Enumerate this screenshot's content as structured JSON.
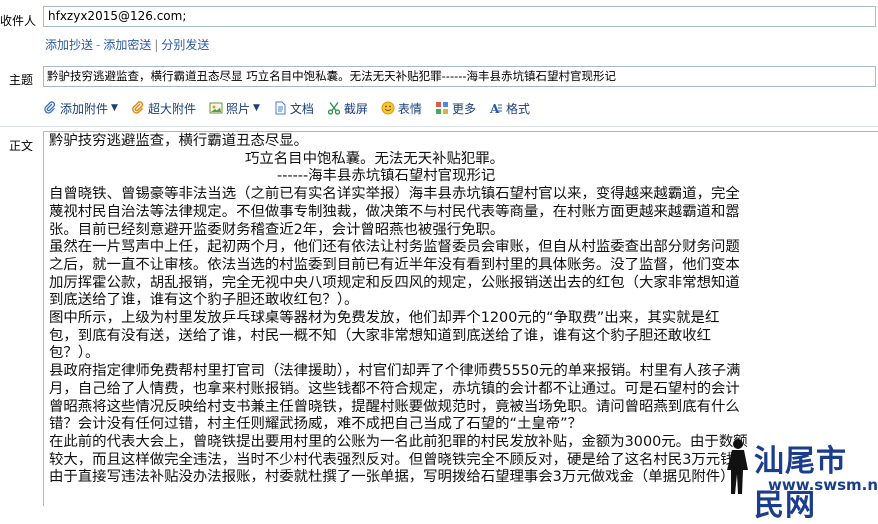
{
  "fields": {
    "to_label": "收件人",
    "to_value": "hfxzyx2015@126.com;",
    "add_cc": "添加抄送",
    "add_bcc": "添加密送",
    "separate_send": "分别发送",
    "subject_label": "主题",
    "subject_value": "黔驴技穷逃避监查，横行霸道丑态尽显   巧立名目中饱私囊。无法无天补贴犯罪------海丰县赤坑镇石望村官现形记",
    "body_label": "正文"
  },
  "toolbar": {
    "attach": "添加附件",
    "big_attach": "超大附件",
    "photo": "照片",
    "doc": "文档",
    "screenshot": "截屏",
    "emoji": "表情",
    "more": "更多",
    "format": "格式"
  },
  "body": {
    "title1": "黔驴技穷逃避监查，横行霸道丑态尽显。",
    "title2": "巧立名目中饱私囊。无法无天补贴犯罪。",
    "title3": "------海丰县赤坑镇石望村官现形记",
    "lines": [
      "自曾晓铁、曾锡豪等非法当选（之前已有实名详实举报）海丰县赤坑镇石望村官以来，变得越来越霸道，完全",
      "蔑视村民自治法等法律规定。不但做事专制独裁，做决策不与村民代表等商量，在村账方面更越来越霸道和嚣",
      "张。目前已经刻意避开监委财务稽查近2年，会计曾昭燕也被强行免职。",
      "虽然在一片骂声中上任，起初两个月，他们还有依法让村务监督委员会审账，但自从村监委查出部分财务问题",
      "之后，就一直不让审核。依法当选的村监委到目前已有近半年没有看到村里的具体账务。没了监督，他们变本",
      "加厉挥霍公款，胡乱报销，完全无视中央八项规定和反四风的规定，公账报销送出去的红包（大家非常想知道",
      "到底送给了谁，谁有这个豹子胆还敢收红包？）。",
      "图中所示，上级为村里发放乒乓球桌等器材为免费发放，他们却弄个1200元的“争取费”出来，其实就是红",
      "包，到底有没有送，送给了谁，村民一概不知（大家非常想知道到底送给了谁，谁有这个豹子胆还敢收红",
      "包？）。",
      "县政府指定律师免费帮村里打官司（法律援助），村官们却弄了个律师费5550元的单来报销。村里有人孩子满",
      "月，自己给了人情费，也拿来村账报销。这些钱都不符合规定，赤坑镇的会计都不让通过。可是石望村的会计",
      "曾昭燕将这些情况反映给村支书兼主任曾晓铁，提醒村账要做规范时，竟被当场免职。请问曾昭燕到底有什么",
      "错？会计没有任何过错，村主任则耀武扬威，难不成把自己当成了石望的“土皇帝”？",
      "在此前的代表大会上，曾晓铁提出要用村里的公账为一名此前犯罪的村民发放补贴，金额为3000元。由于数额",
      "较大，而且这样做完全违法，当时不少村代表强烈反对。但曾晓铁完全不顾反对，硬是给了这名村民3万元钱",
      "由于直接写违法补贴没办法报账，村委就杜撰了一张单据，写明拨给石望理事会3万元做戏金（单据见附件）"
    ]
  },
  "watermark": {
    "logo_text": "汕尾市民网",
    "url": "www.swsm.net"
  },
  "colors": {
    "link": "#2b5aa8",
    "border": "#a9b8c9",
    "watermark": "#1b3e8c"
  }
}
